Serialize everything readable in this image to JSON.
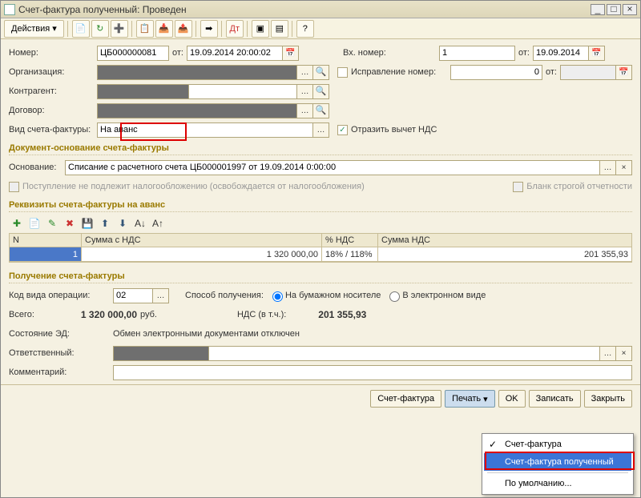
{
  "window": {
    "title": "Счет-фактура полученный: Проведен"
  },
  "toolbar": {
    "actions_label": "Действия"
  },
  "header": {
    "number_label": "Номер:",
    "number": "ЦБ000000081",
    "from_label": "от:",
    "date": "19.09.2014 20:00:02",
    "incoming_label": "Вх. номер:",
    "incoming_number": "1",
    "incoming_from": "от:",
    "incoming_date": "19.09.2014",
    "org_label": "Организация:",
    "correction_label": "Исправление номер:",
    "correction_value": "0",
    "correction_from": "от:",
    "counterparty_label": "Контрагент:",
    "contract_label": "Договор:",
    "type_label": "Вид счета-фактуры:",
    "type_value": "На аванс",
    "reflect_vat_label": "Отразить вычет НДС"
  },
  "basis": {
    "section": "Документ-основание счета-фактуры",
    "label": "Основание:",
    "value": "Списание с расчетного счета ЦБ000001997 от 19.09.2014 0:00:00",
    "no_tax": "Поступление не подлежит налогообложению (освобождается от налогообложения)",
    "strict_form": "Бланк строгой отчетности"
  },
  "details": {
    "section": "Реквизиты счета-фактуры на аванс",
    "cols": {
      "n": "N",
      "sum": "Сумма с НДС",
      "rate": "% НДС",
      "vat": "Сумма НДС"
    },
    "rows": [
      {
        "n": "1",
        "sum": "1 320 000,00",
        "rate": "18% / 118%",
        "vat": "201 355,93"
      }
    ]
  },
  "receipt": {
    "section": "Получение счета-фактуры",
    "opcode_label": "Код вида операции:",
    "opcode": "02",
    "method_label": "Способ получения:",
    "radio1": "На бумажном носителе",
    "radio2": "В электронном виде",
    "total_label": "Всего:",
    "total": "1 320 000,00",
    "total_currency": "руб.",
    "vat_label": "НДС (в т.ч.):",
    "vat": "201 355,93",
    "ed_state_label": "Состояние ЭД:",
    "ed_state": "Обмен электронными документами отключен",
    "responsible_label": "Ответственный:",
    "comment_label": "Комментарий:"
  },
  "buttons": {
    "invoice": "Счет-фактура",
    "print": "Печать",
    "ok": "OK",
    "save": "Записать",
    "close": "Закрыть"
  },
  "menu": {
    "item1": "Счет-фактура",
    "item2": "Счет-фактура полученный",
    "item3": "По умолчанию..."
  }
}
